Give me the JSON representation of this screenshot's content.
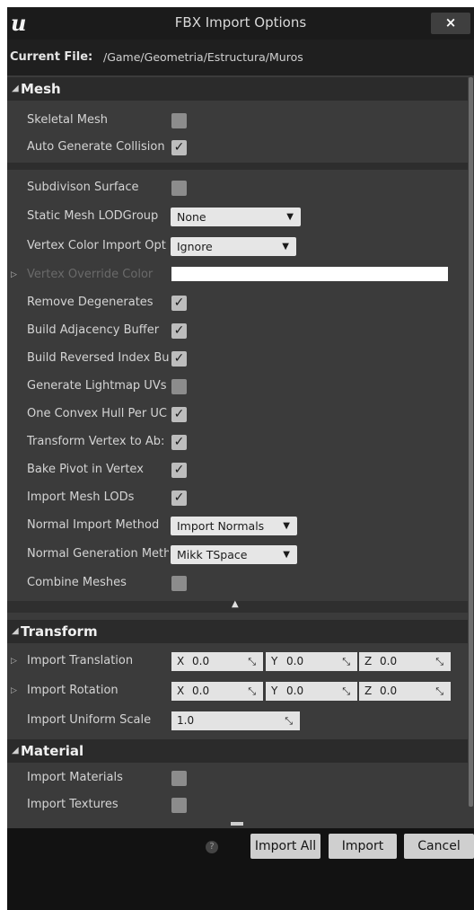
{
  "window": {
    "title": "FBX Import Options",
    "close_label": "×",
    "logo": "u"
  },
  "current_file": {
    "label": "Current File:",
    "path": "/Game/Geometria/Estructura/Muros"
  },
  "mesh": {
    "header": "Mesh",
    "skeletal_mesh": {
      "label": "Skeletal Mesh",
      "checked": false
    },
    "auto_generate_collision": {
      "label": "Auto Generate Collision",
      "checked": true
    },
    "subdivision_surface": {
      "label": "Subdivison Surface",
      "checked": false
    },
    "lod_group": {
      "label": "Static Mesh LODGroup",
      "value": "None"
    },
    "vertex_color_import": {
      "label": "Vertex Color Import Opt",
      "value": "Ignore"
    },
    "vertex_override_color": {
      "label": "Vertex Override Color",
      "color": "#ffffff"
    },
    "remove_degenerates": {
      "label": "Remove Degenerates",
      "checked": true
    },
    "build_adjacency": {
      "label": "Build Adjacency Buffer",
      "checked": true
    },
    "build_reversed_index": {
      "label": "Build Reversed Index Bu",
      "checked": true
    },
    "generate_lightmap_uvs": {
      "label": "Generate Lightmap UVs",
      "checked": false
    },
    "one_convex_hull": {
      "label": "One Convex Hull Per UC",
      "checked": true
    },
    "transform_vertex": {
      "label": "Transform Vertex to Ab:",
      "checked": true
    },
    "bake_pivot": {
      "label": "Bake Pivot in Vertex",
      "checked": true
    },
    "import_mesh_lods": {
      "label": "Import Mesh LODs",
      "checked": true
    },
    "normal_import_method": {
      "label": "Normal Import Method",
      "value": "Import Normals"
    },
    "normal_generation_method": {
      "label": "Normal Generation Meth",
      "value": "Mikk TSpace"
    },
    "combine_meshes": {
      "label": "Combine Meshes",
      "checked": false
    }
  },
  "transform": {
    "header": "Transform",
    "axis_x": "X",
    "axis_y": "Y",
    "axis_z": "Z",
    "translation": {
      "label": "Import Translation",
      "x": "0.0",
      "y": "0.0",
      "z": "0.0"
    },
    "rotation": {
      "label": "Import Rotation",
      "x": "0.0",
      "y": "0.0",
      "z": "0.0"
    },
    "uniform_scale": {
      "label": "Import Uniform Scale",
      "value": "1.0"
    }
  },
  "material": {
    "header": "Material",
    "import_materials": {
      "label": "Import Materials",
      "checked": false
    },
    "import_textures": {
      "label": "Import Textures",
      "checked": false
    }
  },
  "buttons": {
    "help": "?",
    "import_all": "Import All",
    "import": "Import",
    "cancel": "Cancel"
  },
  "icons": {
    "check": "✓",
    "dropdown": "▼",
    "expand": "▷",
    "collapse": "◢",
    "drag": "⤡",
    "collapse_up": "▲"
  }
}
